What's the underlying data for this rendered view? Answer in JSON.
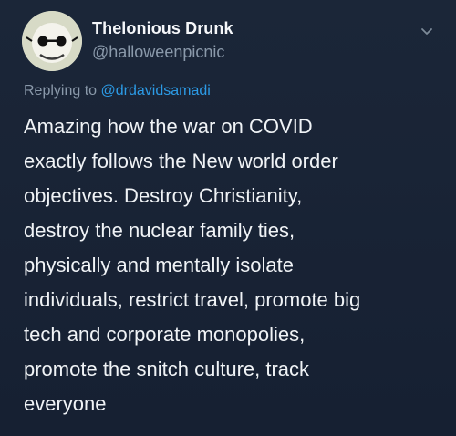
{
  "author": {
    "display_name": "Thelonious Drunk",
    "handle": "@halloweenpicnic"
  },
  "reply": {
    "prefix": "Replying to",
    "target": "@drdavidsamadi"
  },
  "tweet": {
    "lines": [
      "Amazing how the war on COVID",
      "exactly follows the New world order",
      "objectives.  Destroy Christianity,",
      "destroy the nuclear family ties,",
      "physically and mentally isolate",
      "individuals, restrict travel, promote big",
      "tech and corporate monopolies,",
      "promote the snitch culture, track",
      "everyone"
    ]
  },
  "icons": {
    "menu": "chevron-down-icon",
    "avatar": "profile-picture"
  },
  "colors": {
    "background": "#182234",
    "primary_text": "#f0f3f6",
    "secondary_text": "#8a99aa",
    "link": "#2c9be6"
  }
}
